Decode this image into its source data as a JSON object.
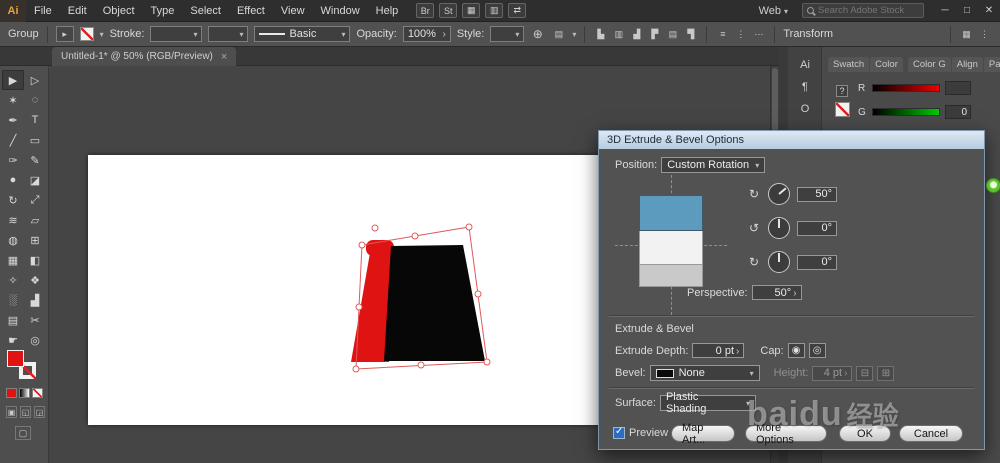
{
  "menubar": {
    "app_icon": "Ai",
    "menus": [
      {
        "name": "menu-file",
        "label": "File"
      },
      {
        "name": "menu-edit",
        "label": "Edit"
      },
      {
        "name": "menu-object",
        "label": "Object"
      },
      {
        "name": "menu-type",
        "label": "Type"
      },
      {
        "name": "menu-select",
        "label": "Select"
      },
      {
        "name": "menu-effect",
        "label": "Effect"
      },
      {
        "name": "menu-view",
        "label": "View"
      },
      {
        "name": "menu-window",
        "label": "Window"
      },
      {
        "name": "menu-help",
        "label": "Help"
      }
    ],
    "app_icons": [
      {
        "name": "bridge-icon",
        "glyph": "Br"
      },
      {
        "name": "stock-icon",
        "glyph": "St"
      },
      {
        "name": "arrange-documents-icon",
        "glyph": "▦"
      },
      {
        "name": "document-layout-icon",
        "glyph": "▥"
      },
      {
        "name": "sync-icon",
        "glyph": "⇄"
      }
    ],
    "workspace_label": "Web",
    "search_placeholder": "Search Adobe Stock",
    "window_controls": {
      "minimize": "─",
      "restore": "□",
      "close": "✕"
    }
  },
  "controlbar": {
    "context_label": "Group",
    "anchor_icon_glyph": "▸",
    "stroke_label": "Stroke:",
    "brush_value": "Basic",
    "opacity_label": "Opacity:",
    "opacity_value": "100%",
    "style_label": "Style:",
    "transform_label": "Transform",
    "globe_glyph": "⊕",
    "docsetup_glyph": "▤",
    "align_icons": [
      {
        "name": "align-left-icon",
        "glyph": "▙"
      },
      {
        "name": "align-center-icon",
        "glyph": "▥"
      },
      {
        "name": "align-right-icon",
        "glyph": "▟"
      },
      {
        "name": "align-top-icon",
        "glyph": "▛"
      },
      {
        "name": "align-middle-icon",
        "glyph": "▤"
      },
      {
        "name": "align-bottom-icon",
        "glyph": "▜"
      }
    ],
    "distribute_icons": [
      {
        "name": "distribute-vertical-icon",
        "glyph": "≡"
      },
      {
        "name": "distribute-horizontal-icon",
        "glyph": "⋮"
      },
      {
        "name": "distribute-spacing-icon",
        "glyph": "⋯"
      }
    ],
    "right_icons": [
      {
        "name": "panel-menu-icon",
        "glyph": "▦"
      },
      {
        "name": "options-icon",
        "glyph": "⋮"
      }
    ]
  },
  "document_tab": {
    "title": "Untitled-1* @ 50% (RGB/Preview)",
    "close_glyph": "×"
  },
  "tools": [
    {
      "name": "selection-tool",
      "glyph": "▶"
    },
    {
      "name": "direct-selection-tool",
      "glyph": "▷"
    },
    {
      "name": "magic-wand-tool",
      "glyph": "✶"
    },
    {
      "name": "lasso-tool",
      "glyph": "◌"
    },
    {
      "name": "pen-tool",
      "glyph": "✒"
    },
    {
      "name": "type-tool",
      "glyph": "T"
    },
    {
      "name": "line-segment-tool",
      "glyph": "╱"
    },
    {
      "name": "rectangle-tool",
      "glyph": "▭"
    },
    {
      "name": "paintbrush-tool",
      "glyph": "✑"
    },
    {
      "name": "pencil-tool",
      "glyph": "✎"
    },
    {
      "name": "blob-brush-tool",
      "glyph": "●"
    },
    {
      "name": "eraser-tool",
      "glyph": "◪"
    },
    {
      "name": "rotate-tool",
      "glyph": "↻"
    },
    {
      "name": "scale-tool",
      "glyph": "⤢"
    },
    {
      "name": "width-tool",
      "glyph": "≋"
    },
    {
      "name": "free-transform-tool",
      "glyph": "▱"
    },
    {
      "name": "shape-builder-tool",
      "glyph": "◍"
    },
    {
      "name": "perspective-grid-tool",
      "glyph": "⊞"
    },
    {
      "name": "mesh-tool",
      "glyph": "▦"
    },
    {
      "name": "gradient-tool",
      "glyph": "◧"
    },
    {
      "name": "eyedropper-tool",
      "glyph": "✧"
    },
    {
      "name": "blend-tool",
      "glyph": "❖"
    },
    {
      "name": "symbol-sprayer-tool",
      "glyph": "░"
    },
    {
      "name": "column-graph-tool",
      "glyph": "▟"
    },
    {
      "name": "artboard-tool",
      "glyph": "▤"
    },
    {
      "name": "slice-tool",
      "glyph": "✂"
    },
    {
      "name": "hand-tool",
      "glyph": "☛"
    },
    {
      "name": "zoom-tool",
      "glyph": "◎"
    }
  ],
  "canvas": {
    "colors": {
      "artboard": "#ffffff",
      "front_face": "#070707",
      "side_face": "#e01313",
      "selection": "#e05a5a"
    }
  },
  "right_dock": {
    "collapsed_icons": [
      {
        "name": "panel-ai-icon",
        "glyph": "Ai"
      },
      {
        "name": "panel-paragraph-icon",
        "glyph": "¶"
      },
      {
        "name": "panel-opentype-icon",
        "glyph": "O"
      }
    ],
    "group1_tabs": [
      {
        "name": "tab-swatches",
        "label": "Swatch"
      },
      {
        "name": "tab-color",
        "label": "Color"
      }
    ],
    "group2_tabs": [
      {
        "name": "tab-color-guide",
        "label": "Color G"
      },
      {
        "name": "tab-align",
        "label": "Align"
      },
      {
        "name": "tab-pathfinder",
        "label": "Pathfin"
      }
    ],
    "color_panel": {
      "help_glyph": "?",
      "channels": [
        {
          "label": "R",
          "value": ""
        },
        {
          "label": "G",
          "value": "0"
        }
      ]
    }
  },
  "dialog": {
    "title": "3D Extrude & Bevel Options",
    "position_label": "Position:",
    "position_value": "Custom Rotation",
    "rotate_x_value": "50°",
    "rotate_y_value": "0°",
    "rotate_z_value": "0°",
    "perspective_label": "Perspective:",
    "perspective_value": "50°",
    "extrude_section_label": "Extrude & Bevel",
    "extrude_depth_label": "Extrude Depth:",
    "extrude_depth_value": "0 pt",
    "cap_label": "Cap:",
    "bevel_label": "Bevel:",
    "bevel_value": "None",
    "height_label": "Height:",
    "height_value": "4 pt",
    "surface_label": "Surface:",
    "surface_value": "Plastic Shading",
    "preview_label": "Preview",
    "map_art_button": "Map Art...",
    "more_options_button": "More Options",
    "ok_button": "OK",
    "cancel_button": "Cancel"
  },
  "watermark": {
    "latin": "baidu",
    "cjk": "经验"
  }
}
